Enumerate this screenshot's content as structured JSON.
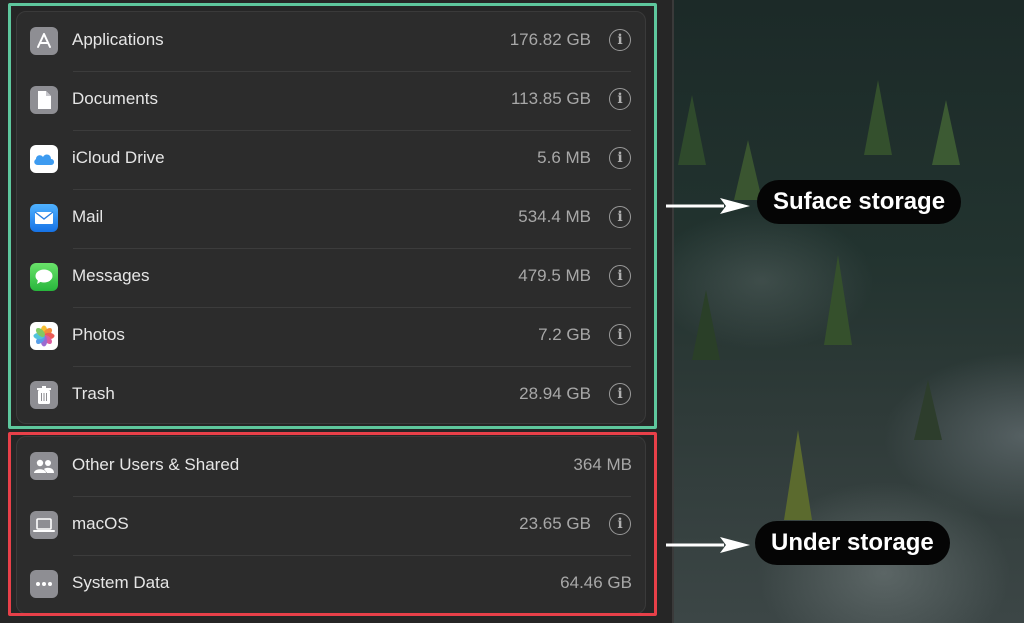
{
  "surface_items": [
    {
      "label": "Applications",
      "size": "176.82 GB",
      "icon": "app-store-icon"
    },
    {
      "label": "Documents",
      "size": "113.85 GB",
      "icon": "document-icon"
    },
    {
      "label": "iCloud Drive",
      "size": "5.6 MB",
      "icon": "icloud-icon"
    },
    {
      "label": "Mail",
      "size": "534.4 MB",
      "icon": "mail-icon"
    },
    {
      "label": "Messages",
      "size": "479.5 MB",
      "icon": "messages-icon"
    },
    {
      "label": "Photos",
      "size": "7.2 GB",
      "icon": "photos-icon"
    },
    {
      "label": "Trash",
      "size": "28.94 GB",
      "icon": "trash-icon"
    }
  ],
  "under_items": [
    {
      "label": "Other Users & Shared",
      "size": "364 MB",
      "icon": "users-icon"
    },
    {
      "label": "macOS",
      "size": "23.65 GB",
      "icon": "laptop-icon"
    },
    {
      "label": "System Data",
      "size": "64.46 GB",
      "icon": "ellipsis-icon"
    }
  ],
  "info_glyph": "i",
  "callouts": {
    "surface": "Suface storage",
    "under": "Under storage"
  },
  "colors": {
    "surface_box": "#5ec79d",
    "under_box": "#e84049",
    "callout_bg": "#050505"
  }
}
